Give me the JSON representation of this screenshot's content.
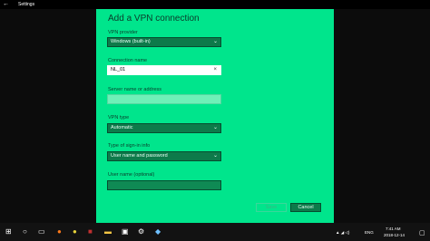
{
  "window": {
    "title": "Settings",
    "back_icon": "back-arrow-icon"
  },
  "dialog": {
    "heading": "Add a VPN connection",
    "vpn_provider": {
      "label": "VPN provider",
      "value": "Windows (built-in)"
    },
    "connection_name": {
      "label": "Connection name",
      "value": "NL_01"
    },
    "server": {
      "label": "Server name or address",
      "value": ""
    },
    "vpn_type": {
      "label": "VPN type",
      "value": "Automatic"
    },
    "sign_in": {
      "label": "Type of sign-in info",
      "value": "User name and password"
    },
    "username": {
      "label": "User name (optional)",
      "value": ""
    },
    "buttons": {
      "save": "Save",
      "cancel": "Cancel"
    }
  },
  "taskbar": {
    "icons": [
      "windows-start-icon",
      "search-icon",
      "task-view-icon",
      "firefox-icon",
      "chrome-icon",
      "media-icon",
      "file-explorer-icon",
      "store-icon",
      "photos-icon",
      "settings-icon",
      "notepad-icon",
      "app-icon"
    ],
    "tray": {
      "language": "ENG",
      "time": "7:41 AM",
      "date": "2018-12-14"
    }
  },
  "colors": {
    "accent": "#00e58c",
    "control": "#0d7a4a",
    "dark": "#0c0c0c"
  }
}
